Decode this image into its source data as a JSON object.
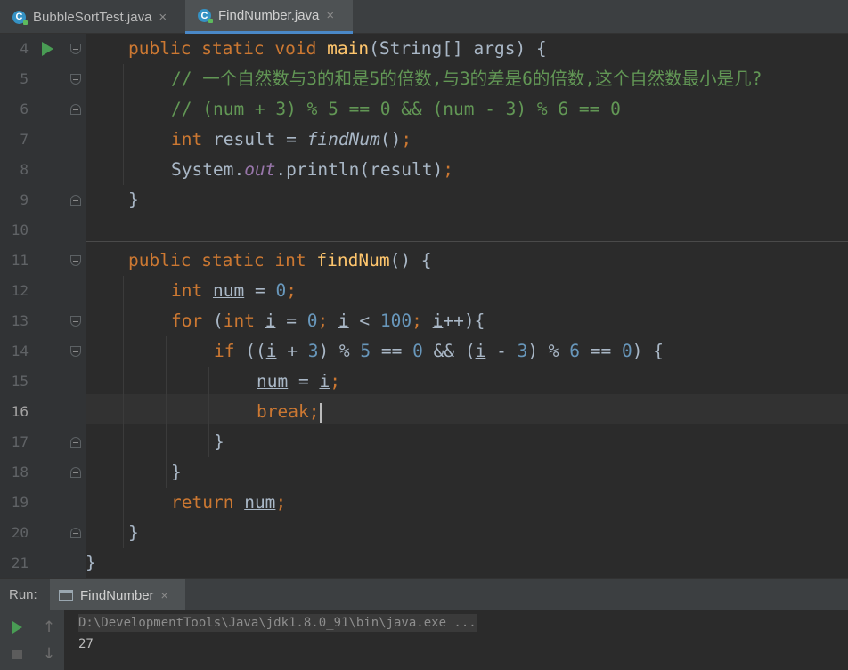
{
  "tabs": [
    {
      "label": "BubbleSortTest.java",
      "active": false,
      "icon": "java-class-icon"
    },
    {
      "label": "FindNumber.java",
      "active": true,
      "icon": "java-class-icon"
    }
  ],
  "close_glyph": "×",
  "class_glyph": "C",
  "editor": {
    "current_line": 16,
    "line_numbers": [
      "4",
      "5",
      "6",
      "7",
      "8",
      "9",
      "10",
      "11",
      "12",
      "13",
      "14",
      "15",
      "16",
      "17",
      "18",
      "19",
      "20",
      "21"
    ],
    "code": {
      "l4": [
        "public",
        " ",
        "static",
        " ",
        "void",
        " ",
        "main",
        "(String[] args) {"
      ],
      "l5": "// 一个自然数与3的和是5的倍数,与3的差是6的倍数,这个自然数最小是几?",
      "l6": "// (num + 3) % 5 == 0 && (num - 3) % 6 == 0",
      "l7": [
        "int",
        " result = ",
        "findNum",
        "()",
        ";"
      ],
      "l8": [
        "System.",
        "out",
        ".println(result)",
        ";"
      ],
      "l9": "}",
      "l11": [
        "public",
        " ",
        "static",
        " ",
        "int",
        " ",
        "findNum",
        "() {"
      ],
      "l12": [
        "int",
        " ",
        "num",
        " = ",
        "0",
        ";"
      ],
      "l13": [
        "for",
        " (",
        "int",
        " ",
        "i",
        " = ",
        "0",
        "; ",
        "i",
        " < ",
        "100",
        "; ",
        "i",
        "++){"
      ],
      "l14": [
        "if",
        " ((",
        "i",
        " + ",
        "3",
        ") % ",
        "5",
        " == ",
        "0",
        " && (",
        "i",
        " - ",
        "3",
        ") % ",
        "6",
        " == ",
        "0",
        ") {"
      ],
      "l15": [
        "num",
        " = ",
        "i",
        ";"
      ],
      "l16": [
        "break",
        ";"
      ],
      "l17": "}",
      "l18": "}",
      "l19": [
        "return",
        " ",
        "num",
        ";"
      ],
      "l20": "}",
      "l21": "}"
    }
  },
  "run_panel": {
    "title": "Run:",
    "tab_label": "FindNumber",
    "console_lines": [
      "D:\\DevelopmentTools\\Java\\jdk1.8.0_91\\bin\\java.exe ...",
      "27"
    ],
    "up_glyph": "↑",
    "down_glyph": "↓"
  },
  "colors": {
    "keyword": "#cc7832",
    "function": "#ffc66d",
    "number": "#6897bb",
    "comment": "#629755",
    "field": "#9876aa",
    "text": "#a9b7c6",
    "background": "#2b2b2b",
    "run": "#499c54"
  }
}
